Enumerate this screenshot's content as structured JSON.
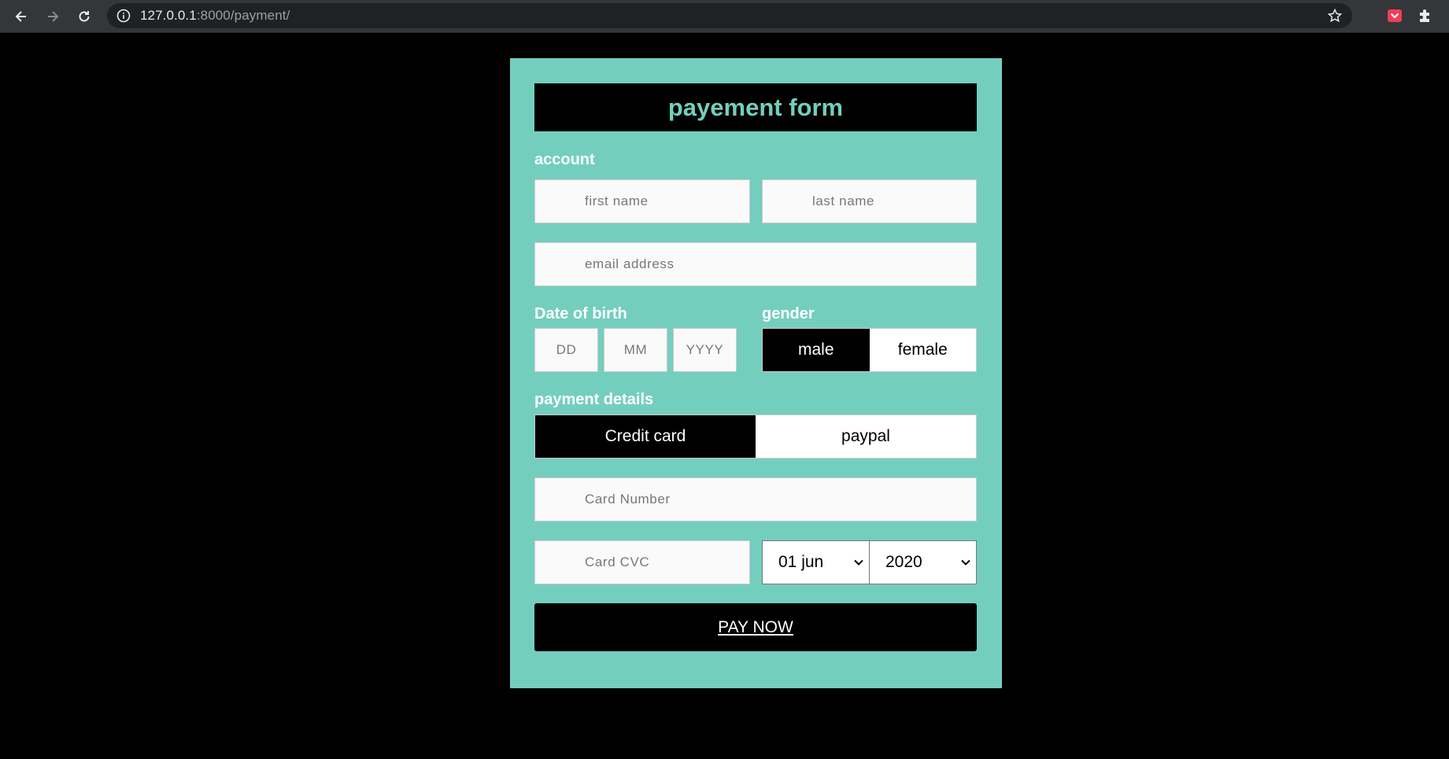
{
  "browser": {
    "url_host": "127.0.0.1",
    "url_rest": ":8000/payment/"
  },
  "form": {
    "title": "payement form",
    "account_label": "account",
    "first_name_placeholder": "first name",
    "last_name_placeholder": "last name",
    "email_placeholder": "email address",
    "dob_label": "Date of birth",
    "dob_day_placeholder": "DD",
    "dob_month_placeholder": "MM",
    "dob_year_placeholder": "YYYY",
    "gender_label": "gender",
    "gender_options": [
      "male",
      "female"
    ],
    "gender_selected": "male",
    "payment_label": "payment details",
    "payment_options": [
      "Credit card",
      "paypal"
    ],
    "payment_selected": "Credit card",
    "card_number_placeholder": "Card Number",
    "card_cvc_placeholder": "Card CVC",
    "expiry_day_value": "01 jun",
    "expiry_year_value": "2020",
    "pay_button_label": "PAY NOW"
  },
  "colors": {
    "card_bg": "#74cebe",
    "page_bg": "#000000",
    "accent_text": "#74cebe"
  }
}
